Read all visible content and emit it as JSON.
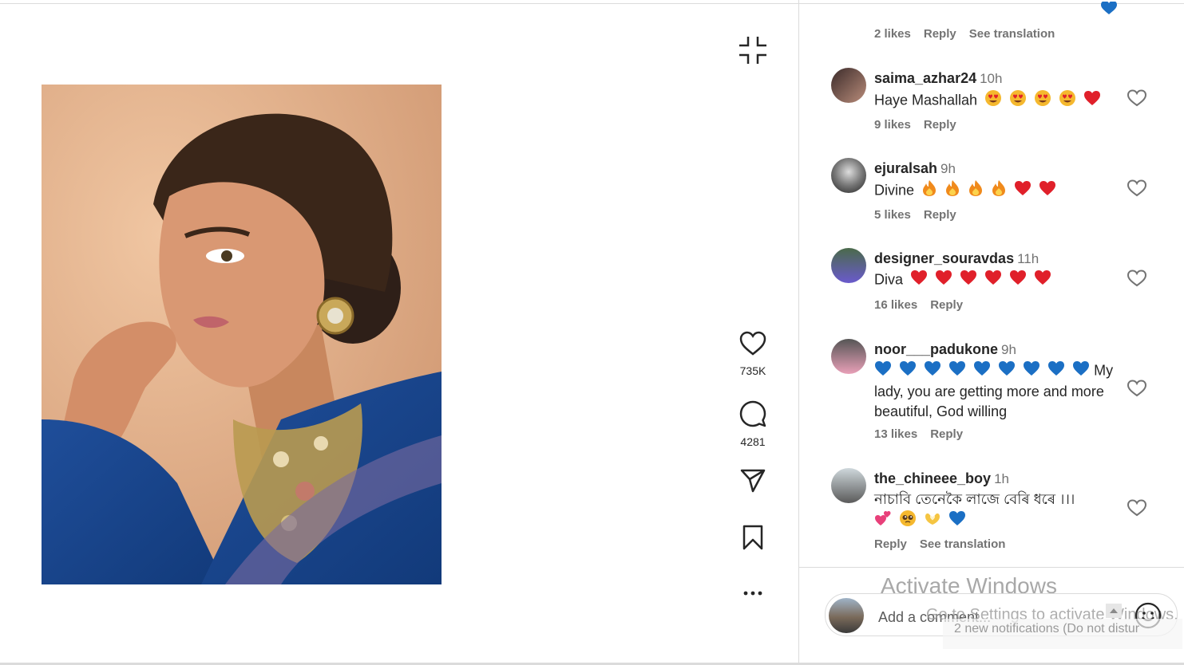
{
  "post": {
    "likes_count": "735K",
    "comments_count": "4281"
  },
  "previous_comment_meta": {
    "likes": "2 likes",
    "reply": "Reply",
    "see_translation": "See translation"
  },
  "comments": [
    {
      "username": "saima_azhar24",
      "time": "10h",
      "text": "Haye Mashallah",
      "emojis": [
        "heart-eyes",
        "heart-eyes",
        "heart-eyes",
        "heart-eyes",
        "red-heart"
      ],
      "likes": "9 likes",
      "reply": "Reply"
    },
    {
      "username": "ejuralsah",
      "time": "9h",
      "text": "Divine",
      "emojis": [
        "fire",
        "fire",
        "fire",
        "fire",
        "red-heart",
        "red-heart"
      ],
      "likes": "5 likes",
      "reply": "Reply"
    },
    {
      "username": "designer_souravdas",
      "time": "11h",
      "text": "Diva",
      "emojis": [
        "red-heart",
        "red-heart",
        "red-heart",
        "red-heart",
        "red-heart",
        "red-heart"
      ],
      "likes": "16 likes",
      "reply": "Reply"
    },
    {
      "username": "noor___padukone",
      "time": "9h",
      "text": "My lady, you are getting more and more beautiful, God willing",
      "emojis": [
        "blue-heart",
        "blue-heart",
        "blue-heart",
        "blue-heart",
        "blue-heart",
        "blue-heart",
        "blue-heart",
        "blue-heart",
        "blue-heart"
      ],
      "likes": "13 likes",
      "reply": "Reply"
    },
    {
      "username": "the_chineee_boy",
      "time": "1h",
      "text": "নাচাবি তেনেকৈ লাজে বেৰি ধৰে ।।।",
      "emojis": [
        "two-hearts",
        "pleading-face",
        "heart-hands",
        "blue-heart"
      ],
      "reply": "Reply",
      "see_translation": "See translation"
    }
  ],
  "add_comment": {
    "placeholder": "Add a comment..."
  },
  "watermark": {
    "title": "Activate Windows",
    "subtitle": "Go to Settings to activate Windows.",
    "notification": "2 new notifications (Do not distur"
  },
  "colors": {
    "blue_heart": "#1b6fc4",
    "red_heart": "#e0202a",
    "meta_gray": "#737373",
    "divider": "#dbdbdb"
  }
}
